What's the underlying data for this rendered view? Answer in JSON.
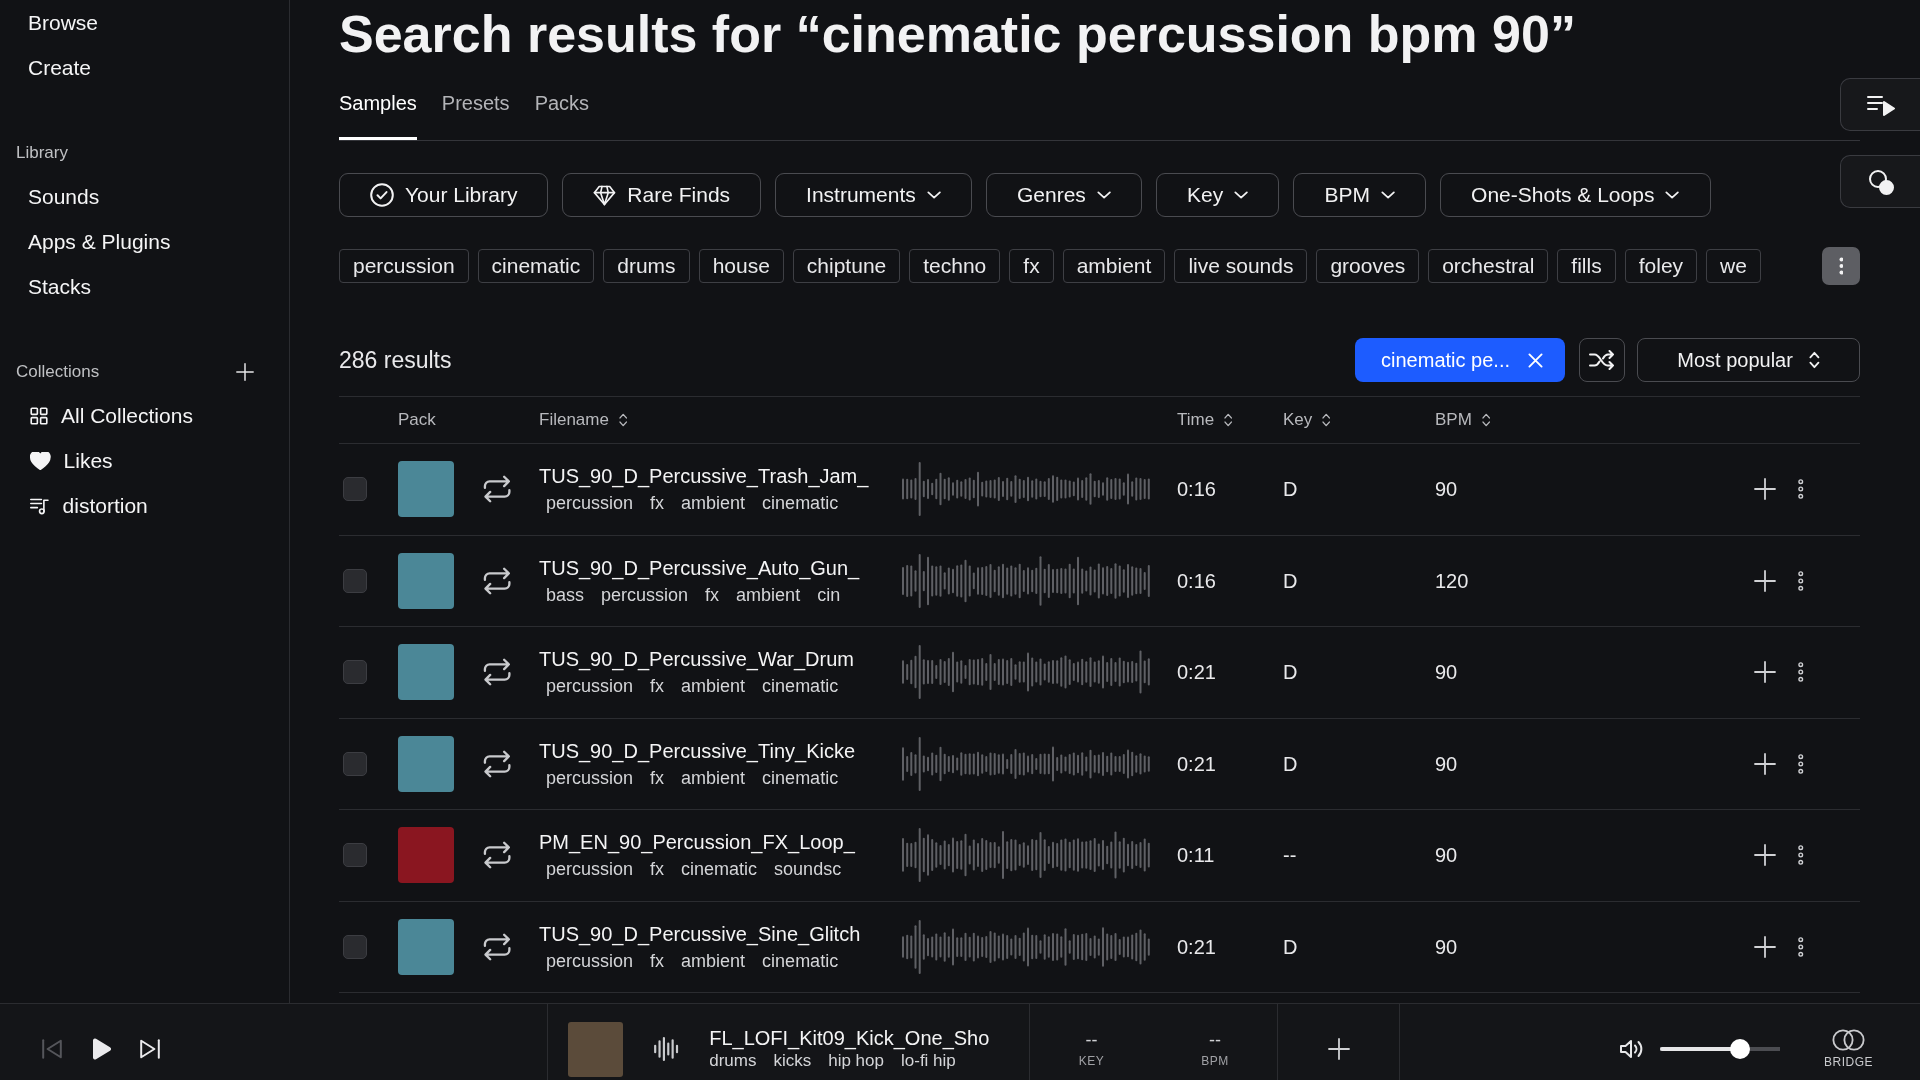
{
  "sidebar": {
    "nav": [
      {
        "label": "Browse"
      },
      {
        "label": "Create"
      }
    ],
    "sections": [
      {
        "kind": "library",
        "title": "Library",
        "items": [
          {
            "label": "Sounds",
            "kind": "link"
          },
          {
            "label": "Apps & Plugins",
            "kind": "link"
          },
          {
            "label": "Stacks",
            "kind": "link"
          }
        ]
      },
      {
        "kind": "collections",
        "title": "Collections",
        "items": [
          {
            "label": "All Collections",
            "kind": "all"
          },
          {
            "label": "Likes",
            "kind": "likes"
          },
          {
            "label": "distortion",
            "kind": "playlist"
          }
        ]
      }
    ]
  },
  "title": "Search results for “cinematic percussion bpm 90”",
  "tabs": [
    {
      "label": "Samples",
      "selected": true
    },
    {
      "label": "Presets",
      "selected": false
    },
    {
      "label": "Packs",
      "selected": false
    }
  ],
  "filters": [
    {
      "label": "Your Library",
      "kind": "library"
    },
    {
      "label": "Rare Finds",
      "kind": "rare"
    },
    {
      "label": "Instruments",
      "kind": "dropdown"
    },
    {
      "label": "Genres",
      "kind": "dropdown"
    },
    {
      "label": "Key",
      "kind": "dropdown"
    },
    {
      "label": "BPM",
      "kind": "dropdown"
    },
    {
      "label": "One-Shots & Loops",
      "kind": "dropdown"
    }
  ],
  "tags": [
    "percussion",
    "cinematic",
    "drums",
    "house",
    "chiptune",
    "techno",
    "fx",
    "ambient",
    "live sounds",
    "grooves",
    "orchestral",
    "fills",
    "foley",
    "we"
  ],
  "results": {
    "count": "286 results",
    "active_filter": "cinematic pe...",
    "sort": "Most popular"
  },
  "table": {
    "columns": [
      {
        "label": "Pack",
        "sortable": false
      },
      {
        "label": "Filename",
        "sortable": true
      },
      {
        "label": "Time",
        "sortable": true
      },
      {
        "label": "Key",
        "sortable": true
      },
      {
        "label": "BPM",
        "sortable": true
      }
    ],
    "rows": [
      {
        "checked": false,
        "pack": {
          "color": "#4b8797"
        },
        "filename": "TUS_90_D_Percussive_Trash_Jam_",
        "tags": [
          "percussion",
          "fx",
          "ambient",
          "cinematic"
        ],
        "time": "0:16",
        "key": "D",
        "bpm": "90"
      },
      {
        "checked": false,
        "pack": {
          "color": "#4b8797"
        },
        "filename": "TUS_90_D_Percussive_Auto_Gun_",
        "tags": [
          "bass",
          "percussion",
          "fx",
          "ambient",
          "cin"
        ],
        "time": "0:16",
        "key": "D",
        "bpm": "120"
      },
      {
        "checked": false,
        "pack": {
          "color": "#4b8797"
        },
        "filename": "TUS_90_D_Percussive_War_Drum",
        "tags": [
          "percussion",
          "fx",
          "ambient",
          "cinematic"
        ],
        "time": "0:21",
        "key": "D",
        "bpm": "90"
      },
      {
        "checked": false,
        "pack": {
          "color": "#4b8797"
        },
        "filename": "TUS_90_D_Percussive_Tiny_Kicke",
        "tags": [
          "percussion",
          "fx",
          "ambient",
          "cinematic"
        ],
        "time": "0:21",
        "key": "D",
        "bpm": "90"
      },
      {
        "checked": false,
        "pack": {
          "color": "#8a1620"
        },
        "filename": "PM_EN_90_Percussion_FX_Loop_",
        "tags": [
          "percussion",
          "fx",
          "cinematic",
          "soundsc"
        ],
        "time": "0:11",
        "key": "--",
        "bpm": "90"
      },
      {
        "checked": false,
        "pack": {
          "color": "#4b8797"
        },
        "filename": "TUS_90_D_Percussive_Sine_Glitch",
        "tags": [
          "percussion",
          "fx",
          "ambient",
          "cinematic"
        ],
        "time": "0:21",
        "key": "D",
        "bpm": "90"
      }
    ]
  },
  "player": {
    "transport": [
      {
        "kind": "previous",
        "disabled": true
      },
      {
        "kind": "play",
        "disabled": false
      },
      {
        "kind": "next",
        "disabled": false
      }
    ],
    "filename": "FL_LOFI_Kit09_Kick_One_Sho",
    "tags": [
      "drums",
      "kicks",
      "hip hop",
      "lo-fi hip"
    ],
    "key": {
      "value": "--",
      "label": "KEY"
    },
    "bpm": {
      "value": "--",
      "label": "BPM"
    },
    "volume": {
      "level": 0.7
    },
    "bridge": "BRIDGE"
  }
}
